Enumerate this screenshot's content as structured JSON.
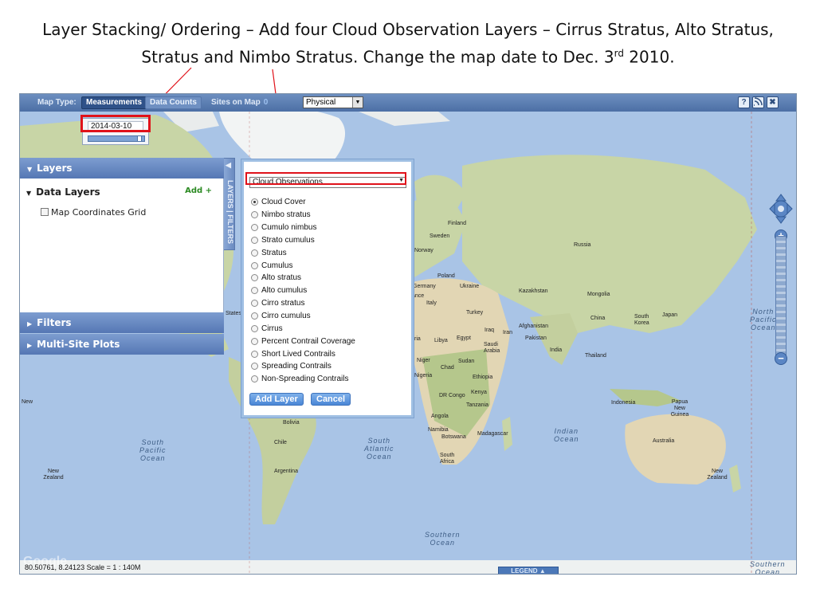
{
  "slide": {
    "title_line1": "Layer Stacking/ Ordering – Add four Cloud Observation Layers – Cirrus Stratus, Alto Stratus,",
    "title_line2_main": "Stratus and Nimbo Stratus. Change the map date to Dec. 3",
    "title_line2_sup": "rd",
    "title_line2_end": " 2010."
  },
  "toolbar": {
    "map_type_label": "Map Type:",
    "measurements_label": "Measurements",
    "data_counts_label": "Data Counts",
    "sites_on_map_label": "Sites on Map",
    "sites_on_map_count": "0",
    "map_type_value": "Physical",
    "help_icon": "?",
    "close_icon": "✖"
  },
  "date_control": {
    "value": "2014-03-10",
    "slider_position": 0.9
  },
  "left_panel": {
    "layers_header": "Layers",
    "data_layers_title": "Data Layers",
    "add_label": "Add +",
    "grid_option": "Map Coordinates Grid",
    "filters_header": "Filters",
    "multisite_header": "Multi-Site Plots",
    "side_tab": "LAYERS | FILTERS"
  },
  "layer_dialog": {
    "category": "Cloud Observations",
    "options": [
      "Cloud Cover",
      "Nimbo stratus",
      "Cumulo nimbus",
      "Strato cumulus",
      "Stratus",
      "Cumulus",
      "Alto stratus",
      "Alto cumulus",
      "Cirro stratus",
      "Cirro cumulus",
      "Cirrus",
      "Percent Contrail Coverage",
      "Short Lived Contrails",
      "Spreading Contrails",
      "Non-Spreading Contrails"
    ],
    "selected_index": 0,
    "add_button": "Add Layer",
    "cancel_button": "Cancel"
  },
  "status": {
    "coords": "80.50761, 8.24123 Scale = 1 : 140M",
    "legend": "LEGEND",
    "watermark": "Google"
  },
  "map_labels": {
    "finland": "Finland",
    "sweden": "Sweden",
    "norway": "Norway",
    "russia": "Russia",
    "poland": "Poland",
    "germany": "Germany",
    "ukraine": "Ukraine",
    "france": "ance",
    "italy": "Italy",
    "kazakhstan": "Kazakhstan",
    "mongolia": "Mongolia",
    "turkey": "Turkey",
    "china": "China",
    "south_korea": "South Korea",
    "japan": "Japan",
    "iraq": "Iraq",
    "iran": "Iran",
    "afghanistan": "Afghanistan",
    "pakistan": "Pakistan",
    "india": "India",
    "thailand": "Thailand",
    "libya": "Libya",
    "egypt": "Egypt",
    "saudi_arabia": "Saudi Arabia",
    "niger": "Niger",
    "chad": "Chad",
    "sudan": "Sudan",
    "nigeria": "Nigeria",
    "ethiopia": "Ethiopia",
    "dr_congo": "DR Congo",
    "kenya": "Kenya",
    "tanzania": "Tanzania",
    "angola": "Angola",
    "namibia": "Namibia",
    "botswana": "Botswana",
    "madagascar": "Madagascar",
    "south_africa": "South Africa",
    "indonesia": "Indonesia",
    "papua": "Papua New Guinea",
    "australia": "Australia",
    "new_zealand_r": "New Zealand",
    "new_zealand_l": "New Zealand",
    "bolivia": "Bolivia",
    "chile": "Chile",
    "argentina": "Argentina",
    "states": "States",
    "new_l": "New",
    "ria": "ria"
  },
  "ocean_labels": {
    "south_pacific": "South\nPacific\nOcean",
    "south_atlantic": "South\nAtlantic\nOcean",
    "indian": "Indian\nOcean",
    "southern": "Southern\nOcean",
    "north_pacific": "North\nPacific\nOcean",
    "southern_r": "Southern\nOcean"
  },
  "colors": {
    "ocean": "#a9c4e6",
    "land": "#c8d5a6",
    "land_dark": "#a8b98a",
    "desert": "#e2d6b4",
    "ice": "#f2f4f4",
    "highlight": "#e0121a",
    "toolbar": "#4c6fa5"
  }
}
